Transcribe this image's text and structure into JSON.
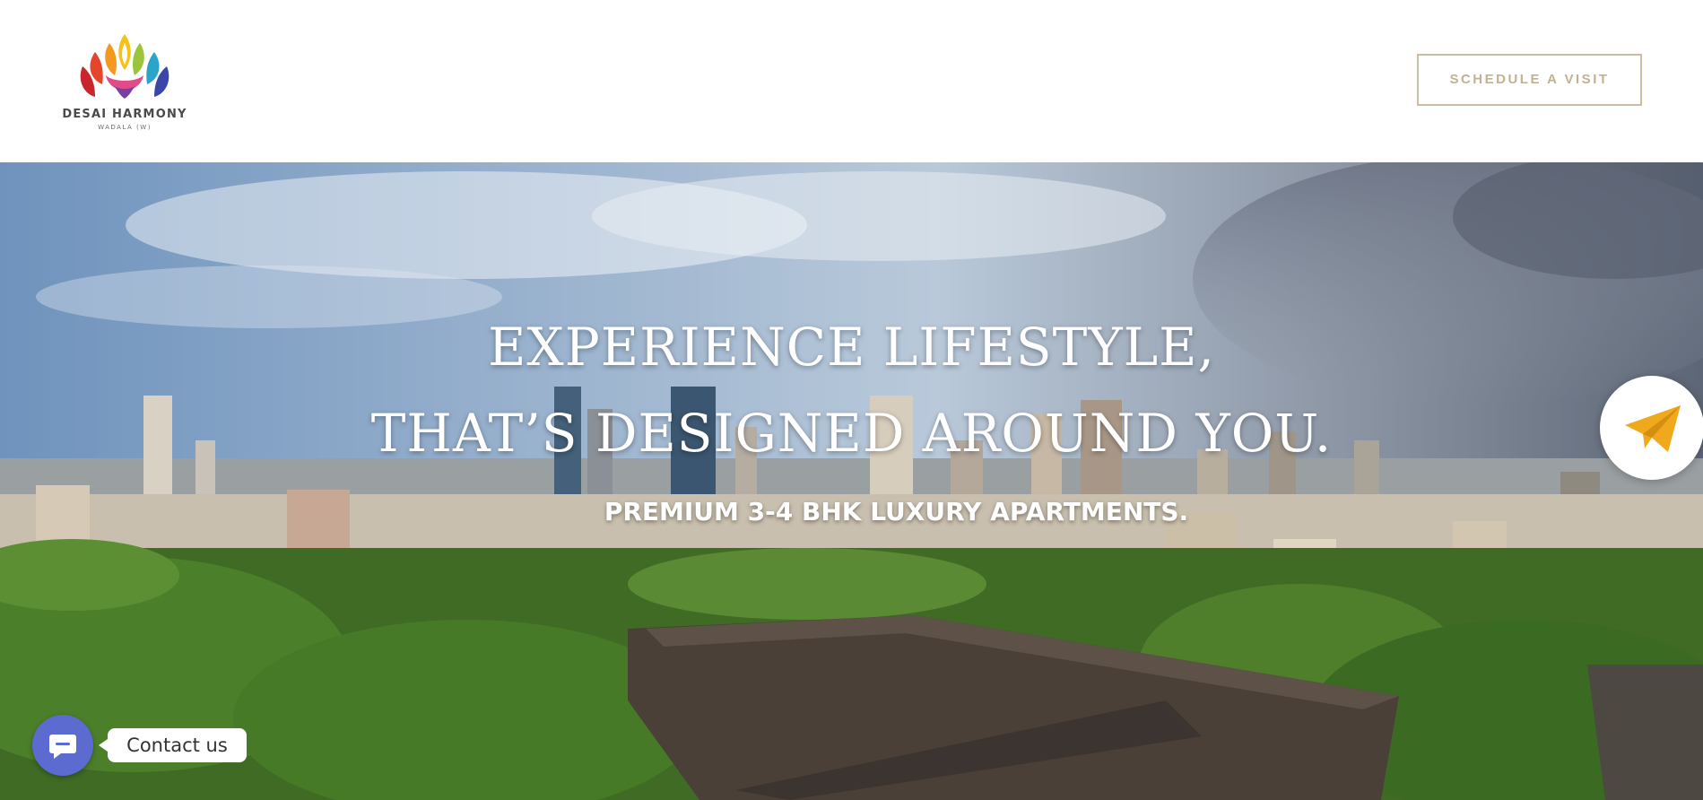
{
  "brand": {
    "name": "DESAI HARMONY",
    "location": "WADALA (W)"
  },
  "header": {
    "cta_label": "SCHEDULE A VISIT"
  },
  "hero": {
    "title_line1": "EXPERIENCE LIFESTYLE,",
    "title_line2": "THAT’S DESIGNED AROUND YOU.",
    "subtitle": "PREMIUM 3-4 BHK LUXURY APARTMENTS."
  },
  "widgets": {
    "contact_label": "Contact us",
    "send_icon": "paper-plane-icon",
    "chat_icon": "chat-bubble-icon"
  },
  "colors": {
    "cta_border": "#cbbd9f",
    "cta_text": "#c1b291",
    "send_icon": "#f0a81c",
    "contact_bubble": "#5b6bd0"
  }
}
